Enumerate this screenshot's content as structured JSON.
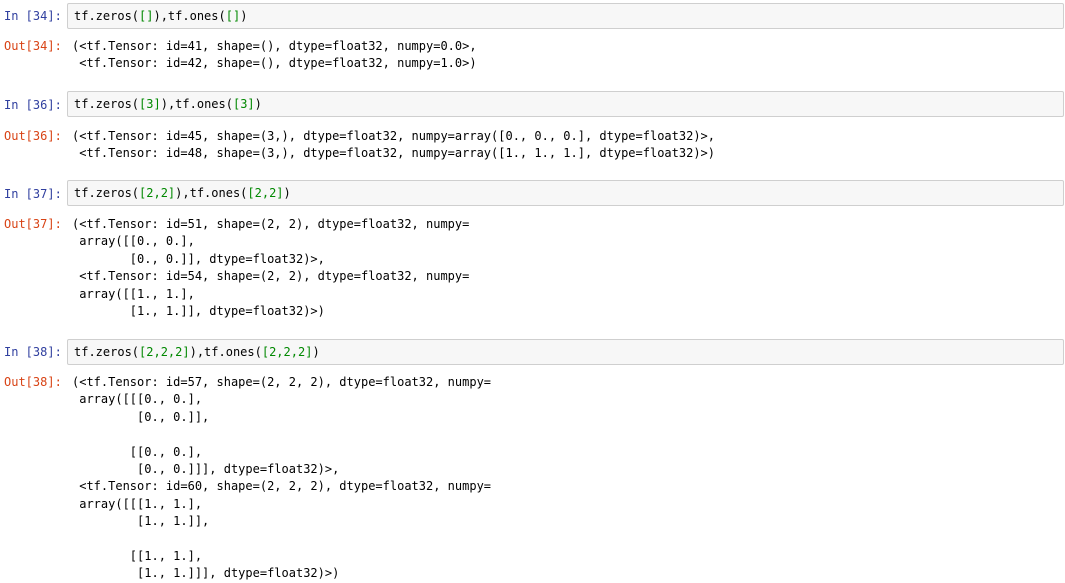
{
  "cells": [
    {
      "in_prompt": "In [34]:",
      "out_prompt": "Out[34]:",
      "code_tokens": [
        {
          "t": "tf.zeros(",
          "k": "name"
        },
        {
          "t": "[]",
          "k": "num"
        },
        {
          "t": "),tf.ones(",
          "k": "name"
        },
        {
          "t": "[]",
          "k": "num"
        },
        {
          "t": ")",
          "k": "name"
        }
      ],
      "output": "(<tf.Tensor: id=41, shape=(), dtype=float32, numpy=0.0>,\n <tf.Tensor: id=42, shape=(), dtype=float32, numpy=1.0>)"
    },
    {
      "in_prompt": "In [36]:",
      "out_prompt": "Out[36]:",
      "code_tokens": [
        {
          "t": "tf.zeros(",
          "k": "name"
        },
        {
          "t": "[3]",
          "k": "num"
        },
        {
          "t": "),tf.ones(",
          "k": "name"
        },
        {
          "t": "[3]",
          "k": "num"
        },
        {
          "t": ")",
          "k": "name"
        }
      ],
      "output": "(<tf.Tensor: id=45, shape=(3,), dtype=float32, numpy=array([0., 0., 0.], dtype=float32)>,\n <tf.Tensor: id=48, shape=(3,), dtype=float32, numpy=array([1., 1., 1.], dtype=float32)>)"
    },
    {
      "in_prompt": "In [37]:",
      "out_prompt": "Out[37]:",
      "code_tokens": [
        {
          "t": "tf.zeros(",
          "k": "name"
        },
        {
          "t": "[2,2]",
          "k": "num"
        },
        {
          "t": "),tf.ones(",
          "k": "name"
        },
        {
          "t": "[2,2]",
          "k": "num"
        },
        {
          "t": ")",
          "k": "name"
        }
      ],
      "output": "(<tf.Tensor: id=51, shape=(2, 2), dtype=float32, numpy=\n array([[0., 0.],\n        [0., 0.]], dtype=float32)>,\n <tf.Tensor: id=54, shape=(2, 2), dtype=float32, numpy=\n array([[1., 1.],\n        [1., 1.]], dtype=float32)>)"
    },
    {
      "in_prompt": "In [38]:",
      "out_prompt": "Out[38]:",
      "code_tokens": [
        {
          "t": "tf.zeros(",
          "k": "name"
        },
        {
          "t": "[2,2,2]",
          "k": "num"
        },
        {
          "t": "),tf.ones(",
          "k": "name"
        },
        {
          "t": "[2,2,2]",
          "k": "num"
        },
        {
          "t": ")",
          "k": "name"
        }
      ],
      "output": "(<tf.Tensor: id=57, shape=(2, 2, 2), dtype=float32, numpy=\n array([[[0., 0.],\n         [0., 0.]],\n\n        [[0., 0.],\n         [0., 0.]]], dtype=float32)>,\n <tf.Tensor: id=60, shape=(2, 2, 2), dtype=float32, numpy=\n array([[[1., 1.],\n         [1., 1.]],\n\n        [[1., 1.],\n         [1., 1.]]], dtype=float32)>)"
    }
  ],
  "colors": {
    "in_prompt": "#303f9f",
    "out_prompt": "#d84315",
    "number_token": "#008800",
    "input_bg": "#f7f7f7",
    "input_border": "#cfcfcf"
  }
}
